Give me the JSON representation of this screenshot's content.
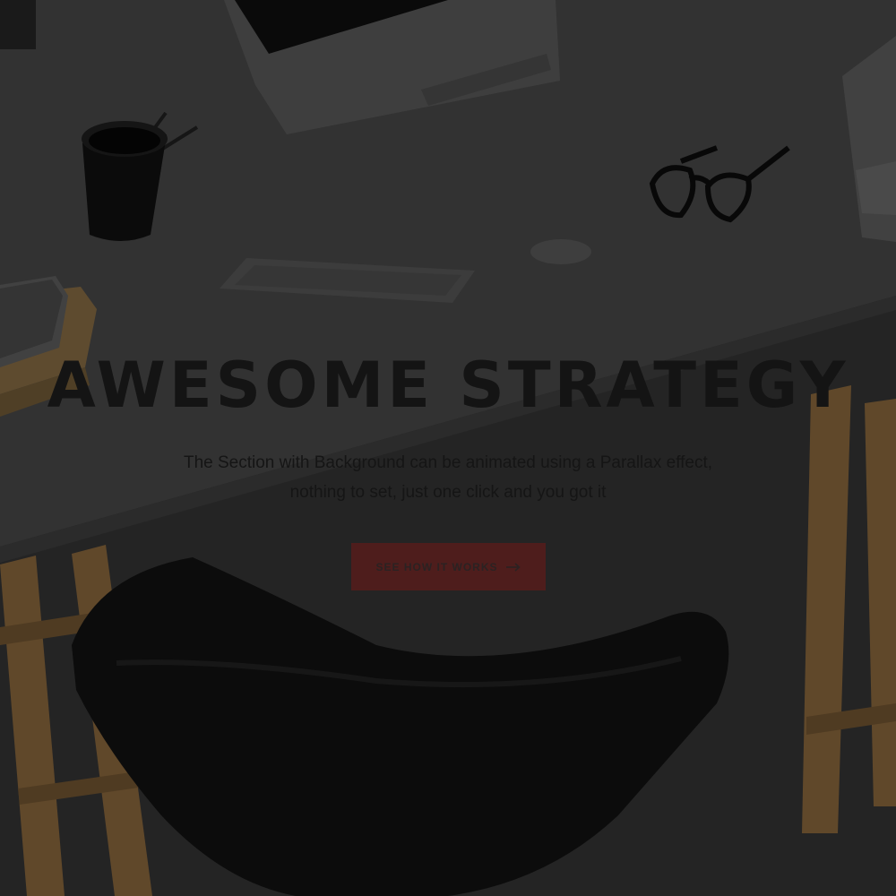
{
  "hero": {
    "title": "AWESOME STRATEGY",
    "subtitle": "The Section with Background can be animated using a Parallax effect, nothing to set, just one click and you got it",
    "cta_label": "SEE HOW IT WORKS",
    "cta_icon": "arrow-right-icon"
  },
  "colors": {
    "desk": "#3a3a3a",
    "background": "#2c2c2c",
    "cta_background": "#4e1d1c",
    "title_text": "#141414",
    "wood": "#7a5a32",
    "chair": "#0e0e0e"
  },
  "background_scene": {
    "items": [
      "monitor",
      "pencil-cup",
      "keyboard",
      "mouse",
      "glasses",
      "laptop",
      "book-stack",
      "chair",
      "trestle-legs"
    ]
  }
}
